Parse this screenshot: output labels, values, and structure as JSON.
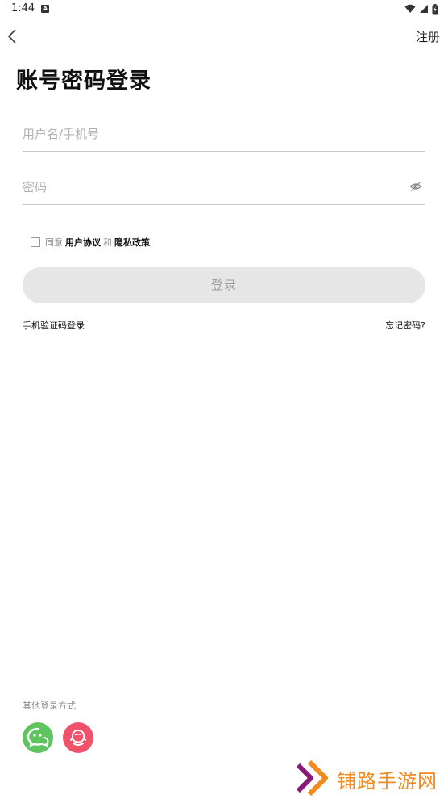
{
  "status_bar": {
    "time": "1:44",
    "a_label": "A"
  },
  "header": {
    "register": "注册"
  },
  "page": {
    "title": "账号密码登录"
  },
  "form": {
    "username_placeholder": "用户名/手机号",
    "username_value": "",
    "password_placeholder": "密码",
    "password_value": "",
    "agree_prefix": "同意",
    "user_agreement": "用户协议",
    "agree_and": "和",
    "privacy_policy": "隐私政策",
    "agree_checked": false,
    "login_button": "登录"
  },
  "links": {
    "sms_login": "手机验证码登录",
    "forgot_password": "忘记密码?"
  },
  "other_login": {
    "title": "其他登录方式",
    "options": [
      "wechat-icon",
      "weibo-icon"
    ]
  },
  "watermark": {
    "text": "铺路手游网"
  },
  "colors": {
    "button_disabled_bg": "#e6e6e6",
    "button_disabled_text": "#9a9a9a",
    "wechat_green": "#5ec55e",
    "weibo_red": "#f0526a",
    "watermark_orange": "#f28a1f",
    "watermark_purple": "#8a1a78"
  }
}
